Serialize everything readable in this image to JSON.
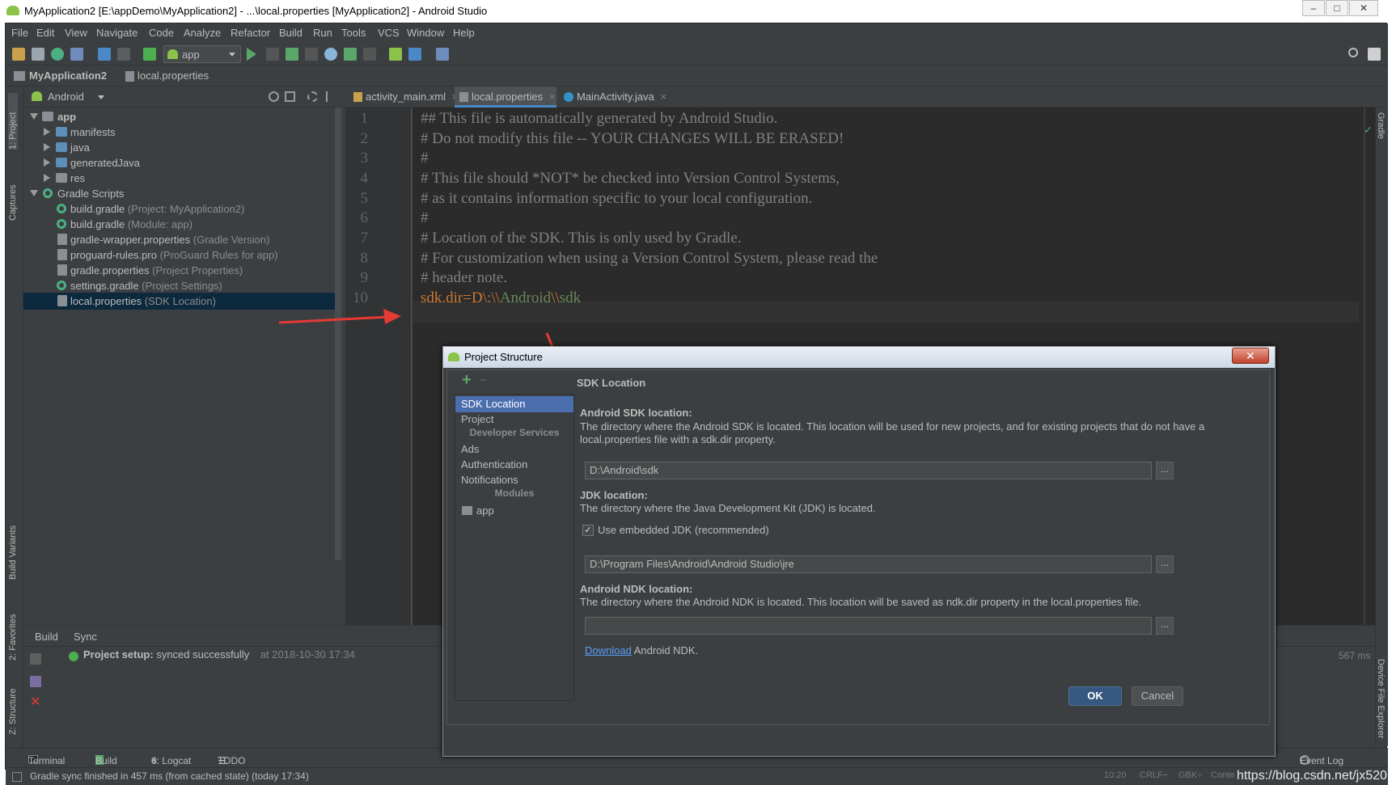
{
  "window": {
    "title": "MyApplication2 [E:\\appDemo\\MyApplication2] - ...\\local.properties [MyApplication2] - Android Studio",
    "controls": [
      "–",
      "□",
      "✕"
    ]
  },
  "menu": [
    "File",
    "Edit",
    "View",
    "Navigate",
    "Code",
    "Analyze",
    "Refactor",
    "Build",
    "Run",
    "Tools",
    "VCS",
    "Window",
    "Help"
  ],
  "toolbar": {
    "run_config": "app"
  },
  "breadcrumb": {
    "project": "MyApplication2",
    "file": "local.properties"
  },
  "left_stripe": {
    "project": "1: Project",
    "captures": "Captures",
    "build_variants": "Build Variants",
    "favorites": "2: Favorites",
    "structure": "Z: Structure"
  },
  "right_stripe": {
    "gradle": "Gradle",
    "device_file_explorer": "Device File Explorer"
  },
  "project_panel": {
    "view_mode": "Android",
    "tree": [
      {
        "label": "app",
        "sub": "",
        "kind": "folder-module"
      },
      {
        "label": "manifests",
        "sub": "",
        "kind": "folder"
      },
      {
        "label": "java",
        "sub": "",
        "kind": "folder"
      },
      {
        "label": "generatedJava",
        "sub": "",
        "kind": "folder"
      },
      {
        "label": "res",
        "sub": "",
        "kind": "folder"
      },
      {
        "label": "Gradle Scripts",
        "sub": "",
        "kind": "gradle"
      },
      {
        "label": "build.gradle",
        "sub": "(Project: MyApplication2)",
        "kind": "gradle"
      },
      {
        "label": "build.gradle",
        "sub": "(Module: app)",
        "kind": "gradle"
      },
      {
        "label": "gradle-wrapper.properties",
        "sub": "(Gradle Version)",
        "kind": "prop"
      },
      {
        "label": "proguard-rules.pro",
        "sub": "(ProGuard Rules for app)",
        "kind": "prop"
      },
      {
        "label": "gradle.properties",
        "sub": "(Project Properties)",
        "kind": "prop"
      },
      {
        "label": "settings.gradle",
        "sub": "(Project Settings)",
        "kind": "gradle"
      },
      {
        "label": "local.properties",
        "sub": "(SDK Location)",
        "kind": "prop"
      }
    ]
  },
  "editor": {
    "tabs": [
      {
        "label": "activity_main.xml"
      },
      {
        "label": "local.properties"
      },
      {
        "label": "MainActivity.java"
      }
    ],
    "lines": [
      "## This file is automatically generated by Android Studio.",
      "# Do not modify this file -- YOUR CHANGES WILL BE ERASED!",
      "#",
      "# This file should *NOT* be checked into Version Control Systems,",
      "# as it contains information specific to your local configuration.",
      "#",
      "# Location of the SDK. This is only used by Gradle.",
      "# For customization when using a Version Control System, please read the",
      "# header note."
    ],
    "line_numbers": [
      "1",
      "2",
      "3",
      "4",
      "5",
      "6",
      "7",
      "8",
      "9",
      "10"
    ],
    "last_line": {
      "key": "sdk.dir",
      "eq": "=",
      "value_a": "D\\:\\\\",
      "value_b": "Android",
      "value_c": "\\\\",
      "value_d": "sdk"
    }
  },
  "build_panel": {
    "tabs": [
      "Build",
      "Sync"
    ],
    "status_bold": "Project setup:",
    "status_text": "synced successfully",
    "timestamp": "at 2018-10-30 17:34",
    "duration": "567 ms"
  },
  "bottom_tabs": [
    "Terminal",
    "Build",
    "6: Logcat",
    "TODO"
  ],
  "event_log": "Event Log",
  "status_bar": {
    "message": "Gradle sync finished in 457 ms (from cached state) (today 17:34)",
    "position": "10:20",
    "line_sep": "CRLF÷",
    "encoding": "GBK÷",
    "context": "Context: <no context>",
    "watermark": "https://blog.csdn.net/jx520"
  },
  "dialog": {
    "title": "Project Structure",
    "close": "✕",
    "add": "+",
    "remove": "–",
    "sidebar": {
      "sdk_location": "SDK Location",
      "project": "Project",
      "developer_services": "Developer Services",
      "ads": "Ads",
      "authentication": "Authentication",
      "notifications": "Notifications",
      "modules": "Modules",
      "app": "app"
    },
    "heading": "SDK Location",
    "sdk": {
      "label": "Android SDK location:",
      "desc1": "The directory where the Android SDK is located. This location will be used for new projects, and for existing projects that do not have a",
      "desc2": "local.properties file with a sdk.dir property.",
      "value": "D:\\Android\\sdk"
    },
    "jdk": {
      "label": "JDK location:",
      "desc": "The directory where the Java Development Kit (JDK) is located.",
      "checkbox": "Use embedded JDK (recommended)",
      "value": "D:\\Program Files\\Android\\Android Studio\\jre"
    },
    "ndk": {
      "label": "Android NDK location:",
      "desc": "The directory where the Android NDK is located. This location will be saved as ndk.dir property in the local.properties file.",
      "value": "",
      "download_link": "Download",
      "download_rest": "Android NDK."
    },
    "browse": "...",
    "ok": "OK",
    "cancel": "Cancel"
  },
  "colors": {
    "bg": "#3c3f41",
    "editor": "#2b2b2b",
    "selection": "#4b6eaf",
    "arrow": "#e53935",
    "keyword": "#cc7832",
    "string": "#6a8759"
  }
}
